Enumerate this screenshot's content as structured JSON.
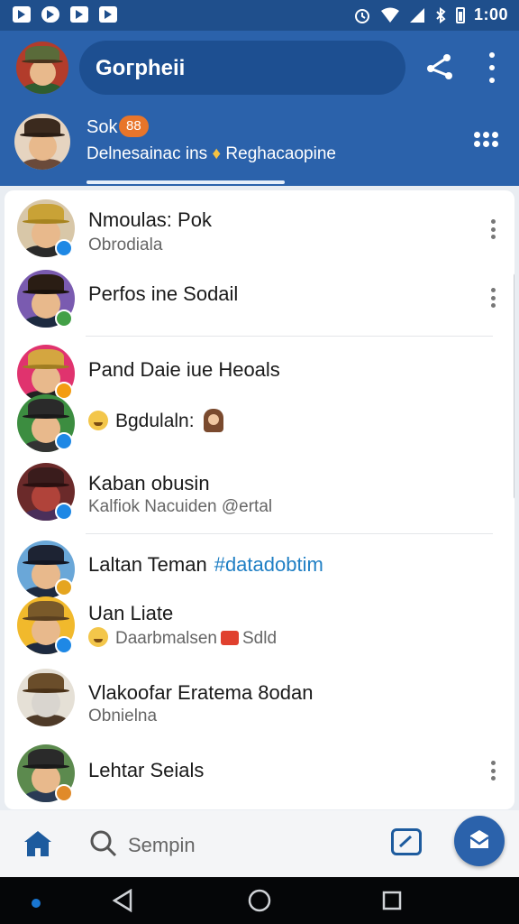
{
  "status_bar": {
    "time": "1:00"
  },
  "header": {
    "title": "Gогрhеіі",
    "profile": {
      "name": "Sok",
      "badge": "88",
      "status_before": "Delnesainac ins",
      "status_after": "Reghacaopine"
    }
  },
  "chats": [
    {
      "name": "Nmoulas: Pok",
      "subtitle": "Obrodiala",
      "badge_color": "#1e88e5",
      "avatar_bg": "#d8c7a8"
    },
    {
      "name": "Perfos ine Sodail",
      "subtitle": "",
      "badge_color": "#43a047",
      "avatar_bg": "#7a5bb0"
    },
    {
      "name": "Pand Daie iue Heoals",
      "subtitle": "",
      "badge_color": "#f39c12",
      "avatar_bg": "#e0336e"
    },
    {
      "name": "",
      "subtitle": "Bgdulaln:",
      "badge_color": "#1e88e5",
      "avatar_bg": "#3c8d40"
    },
    {
      "name": "Kaban obusin",
      "subtitle": "Kalfiok Nacuiden @ertal",
      "badge_color": "#1e88e5",
      "avatar_bg": "#6b2a2a"
    },
    {
      "name": "Laltan Teman",
      "hashtag": "#datadobtim",
      "subtitle": "",
      "badge_color": "#e5a520",
      "avatar_bg": "#6aa7d8"
    },
    {
      "name": "Uan Liate",
      "subtitle": "Daarbmalsen",
      "subtitle_tail": "Sdld",
      "badge_color": "#1e88e5",
      "avatar_bg": "#f1b92c"
    },
    {
      "name": "Vlakoofar Eratema 8odan",
      "subtitle": "Obnielna",
      "badge_color": "",
      "avatar_bg": "#e5e0d6"
    },
    {
      "name": "Lehtar Seials",
      "subtitle": "",
      "badge_color": "#e08a2a",
      "avatar_bg": "#5c8a4e"
    }
  ],
  "bottom_bar": {
    "search_label": "Sempin"
  },
  "colors": {
    "primary": "#2b62ab",
    "header_dark": "#1f4f8c",
    "link": "#1f7fc4"
  }
}
